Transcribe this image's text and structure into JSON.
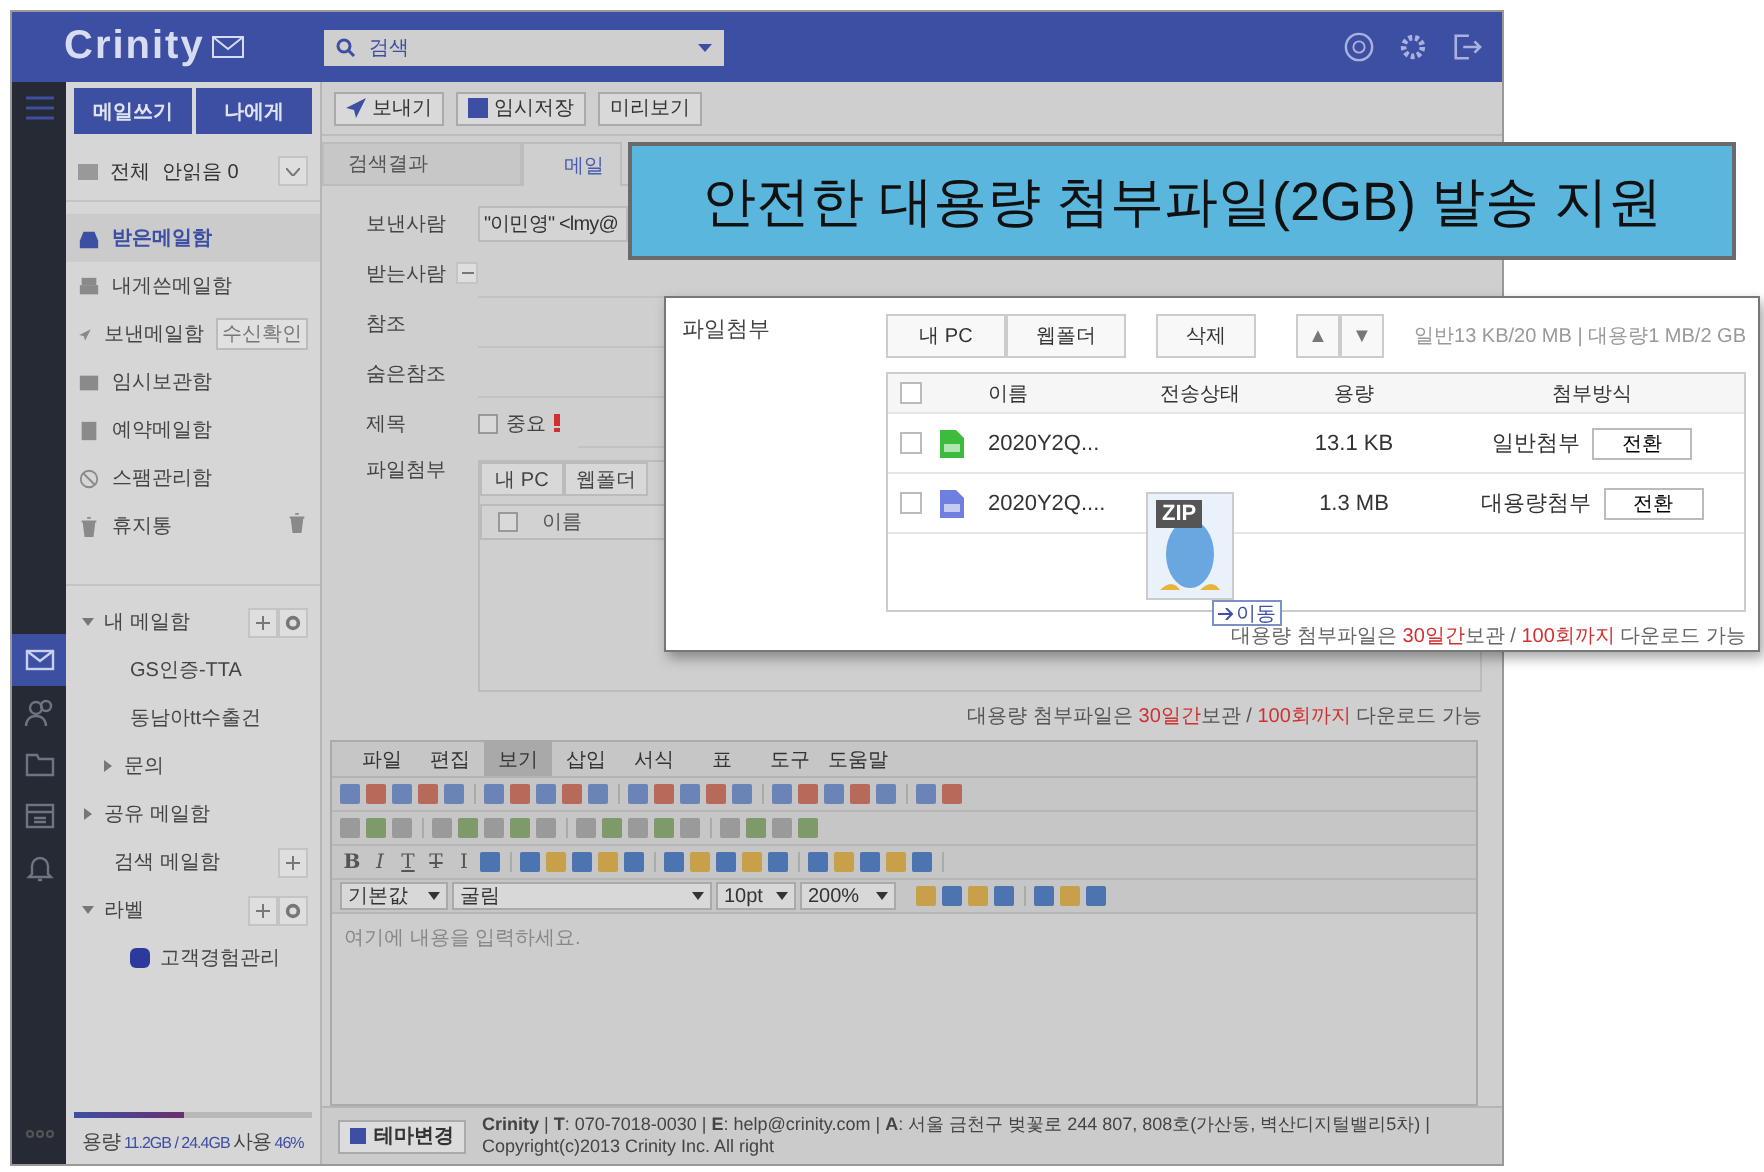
{
  "header": {
    "logo": "Crinity",
    "search_placeholder": "검색"
  },
  "rail": [
    {
      "kind": "mail",
      "selected": true
    },
    {
      "kind": "contacts",
      "selected": false
    },
    {
      "kind": "folder",
      "selected": false
    },
    {
      "kind": "calendar",
      "selected": false
    },
    {
      "kind": "bell",
      "selected": false
    }
  ],
  "sidebar": {
    "compose_buttons": [
      "메일쓰기",
      "나에게"
    ],
    "summary": {
      "all": "전체",
      "unread": "안읽음 0"
    },
    "folders": [
      {
        "label": "받은메일함",
        "kind": "inbox",
        "selected": true
      },
      {
        "label": "내게쓴메일함",
        "kind": "self",
        "selected": false
      },
      {
        "label": "보낸메일함",
        "kind": "sent",
        "selected": false,
        "badge": "수신확인"
      },
      {
        "label": "임시보관함",
        "kind": "draft",
        "selected": false
      },
      {
        "label": "예약메일함",
        "kind": "scheduled",
        "selected": false
      },
      {
        "label": "스팸관리함",
        "kind": "spam",
        "selected": false
      },
      {
        "label": "휴지통",
        "kind": "trash",
        "selected": false
      }
    ],
    "tree": [
      {
        "label": "내 메일함",
        "expanded": true,
        "add": true,
        "settings": true,
        "children": [
          {
            "label": "GS인증-TTA"
          },
          {
            "label": "동남아tt수출건"
          },
          {
            "label": "문의",
            "expanded": false
          }
        ]
      },
      {
        "label": "공유 메일함",
        "expanded": false
      },
      {
        "label": "검색 메일함",
        "add": true
      },
      {
        "label": "라벨",
        "expanded": true,
        "add": true,
        "settings": true,
        "children": [
          {
            "label": "고객경험관리",
            "color": "#2c3a9e"
          }
        ]
      }
    ],
    "storage": {
      "label": "용량",
      "used": "11.2GB / 24.4GB",
      "suffix": "사용",
      "percent": "46%",
      "level": 0.46
    }
  },
  "toolbar": [
    "보내기",
    "임시저장",
    "미리보기"
  ],
  "tabs": [
    {
      "label": "검색결과",
      "selected": false
    },
    {
      "label": "메일",
      "selected": true
    }
  ],
  "form": {
    "sender_label": "보낸사람",
    "sender_value": "\"이민영\" <lmy@",
    "to_label": "받는사람",
    "cc_label": "참조",
    "bcc_label": "숨은참조",
    "subject_label": "제목",
    "important_label": "중요",
    "important_checked": false,
    "attach_label": "파일첨부",
    "attach_buttons": [
      "내 PC",
      "웹폴더"
    ],
    "attach_column": "이름",
    "select_all_checked": false,
    "note": [
      {
        "text": "대용량 첨부파일은 ",
        "highlight": false
      },
      {
        "text": "30일간",
        "highlight": true
      },
      {
        "text": "보관 / ",
        "highlight": false
      },
      {
        "text": "100회까지",
        "highlight": true
      },
      {
        "text": " 다운로드 가능",
        "highlight": false
      }
    ]
  },
  "editor": {
    "menu": [
      {
        "label": "파일",
        "selected": false
      },
      {
        "label": "편집",
        "selected": false
      },
      {
        "label": "보기",
        "selected": true
      },
      {
        "label": "삽입",
        "selected": false
      },
      {
        "label": "서식",
        "selected": false
      },
      {
        "label": "표",
        "selected": false
      },
      {
        "label": "도구",
        "selected": false
      },
      {
        "label": "도움말",
        "selected": false
      }
    ],
    "format_buttons": [
      {
        "label": "B",
        "kind": "bold"
      },
      {
        "label": "I",
        "kind": "italic"
      },
      {
        "label": "T",
        "kind": "underline"
      },
      {
        "label": "T",
        "kind": "strike"
      },
      {
        "label": "I",
        "kind": "plain"
      }
    ],
    "selects": [
      "기본값",
      "굴림",
      "10pt",
      "200%"
    ],
    "placeholder": "여기에 내용을 입력하세요."
  },
  "footer": {
    "theme_button": "테마변경",
    "text": "**Crinity** | **T**: 070-7018-0030 | **E**: help@crinity.com | **A**: 서울 금천구 벚꽃로 244 807, 808호(가산동, 벽산디지털밸리5차) | Copyright(c)2013 Crinity Inc. All right"
  },
  "callout": {
    "text": "안전한 대용량 첨부파일(2GB) 발송 지원"
  },
  "popup": {
    "title": "파일첨부",
    "buttons": [
      "내 PC",
      "웹폴더"
    ],
    "delete_button": "삭제",
    "up": "▲",
    "down": "▼",
    "quota": "일반13 KB/20 MB | 대용량1 MB/2 GB",
    "select_all_checked": false,
    "columns": [
      "이름",
      "전송상태",
      "용량",
      "첨부방식"
    ],
    "rows": [
      {
        "name": "2020Y2Q...",
        "kind": "xls",
        "checked": false,
        "size": "13.1 KB",
        "method": "일반첨부",
        "action": "전환"
      },
      {
        "name": "2020Y2Q....",
        "kind": "doc",
        "checked": false,
        "size": "1.3 MB",
        "method": "대용량첨부",
        "action": "전환"
      }
    ],
    "note": [
      {
        "text": "대용량 첨부파일은 ",
        "highlight": false
      },
      {
        "text": "30일간",
        "highlight": true
      },
      {
        "text": "보관 / ",
        "highlight": false
      },
      {
        "text": "100회까지",
        "highlight": true
      },
      {
        "text": " 다운로드 가능",
        "highlight": false
      }
    ],
    "drag": {
      "label": "ZIP",
      "tooltip": "이동"
    }
  }
}
